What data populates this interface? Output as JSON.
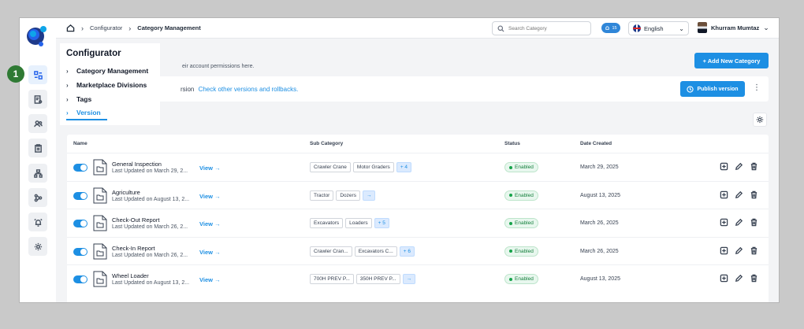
{
  "step_badge": "1",
  "breadcrumb": {
    "items": [
      "Configurator",
      "Category Management"
    ]
  },
  "search": {
    "placeholder": "Search Category"
  },
  "notifications": {
    "count": "15"
  },
  "language": {
    "selected": "English"
  },
  "user": {
    "name": "Khurram Mumtaz"
  },
  "page": {
    "description": "eir account permissions here.",
    "add_button_label": "+ Add New Category"
  },
  "version_bar": {
    "prefix": "rsion",
    "link_text": "Check other versions and rollbacks.",
    "publish_label": "Publish version"
  },
  "dropdown": {
    "title": "Configurator",
    "items": [
      {
        "label": "Category Management"
      },
      {
        "label": "Marketplace Divisions"
      },
      {
        "label": "Tags"
      },
      {
        "label": "Version"
      }
    ]
  },
  "table": {
    "headers": {
      "name": "Name",
      "sub_category": "Sub Category",
      "status": "Status",
      "date_created": "Date Created"
    },
    "view_label": "View",
    "rows": [
      {
        "name": "General Inspection",
        "updated": "Last Updated on March 29, 2...",
        "chips": [
          "Crawler Crane",
          "Motor Graders"
        ],
        "more": "+ 4",
        "status": "Enabled",
        "date": "March 29, 2025"
      },
      {
        "name": "Agriculture",
        "updated": "Last Updated on August 13, 2...",
        "chips": [
          "Tractor",
          "Dozers"
        ],
        "more": "→",
        "status": "Enabled",
        "date": "August 13, 2025"
      },
      {
        "name": "Check-Out Report",
        "updated": "Last Updated on March 26, 2...",
        "chips": [
          "Excavators",
          "Loaders"
        ],
        "more": "+ 5",
        "status": "Enabled",
        "date": "March 26, 2025"
      },
      {
        "name": "Check-In Report",
        "updated": "Last Updated on March 26, 2...",
        "chips": [
          "Crawler Cran...",
          "Excavators C..."
        ],
        "more": "+ 6",
        "status": "Enabled",
        "date": "March 26, 2025"
      },
      {
        "name": "Wheel Loader",
        "updated": "Last Updated on August 13, 2...",
        "chips": [
          "700H PREV P...",
          "350H PREV P..."
        ],
        "more": "→",
        "status": "Enabled",
        "date": "August 13, 2025"
      }
    ]
  },
  "icons": {
    "sidebar": [
      "configurator-icon",
      "report-search-icon",
      "users-icon",
      "clipboard-icon",
      "hierarchy-icon",
      "workflow-icon",
      "alarm-icon",
      "settings-icon"
    ]
  },
  "colors": {
    "primary": "#1d8fe3",
    "success": "#15803d",
    "step_badge": "#2f7a34"
  }
}
